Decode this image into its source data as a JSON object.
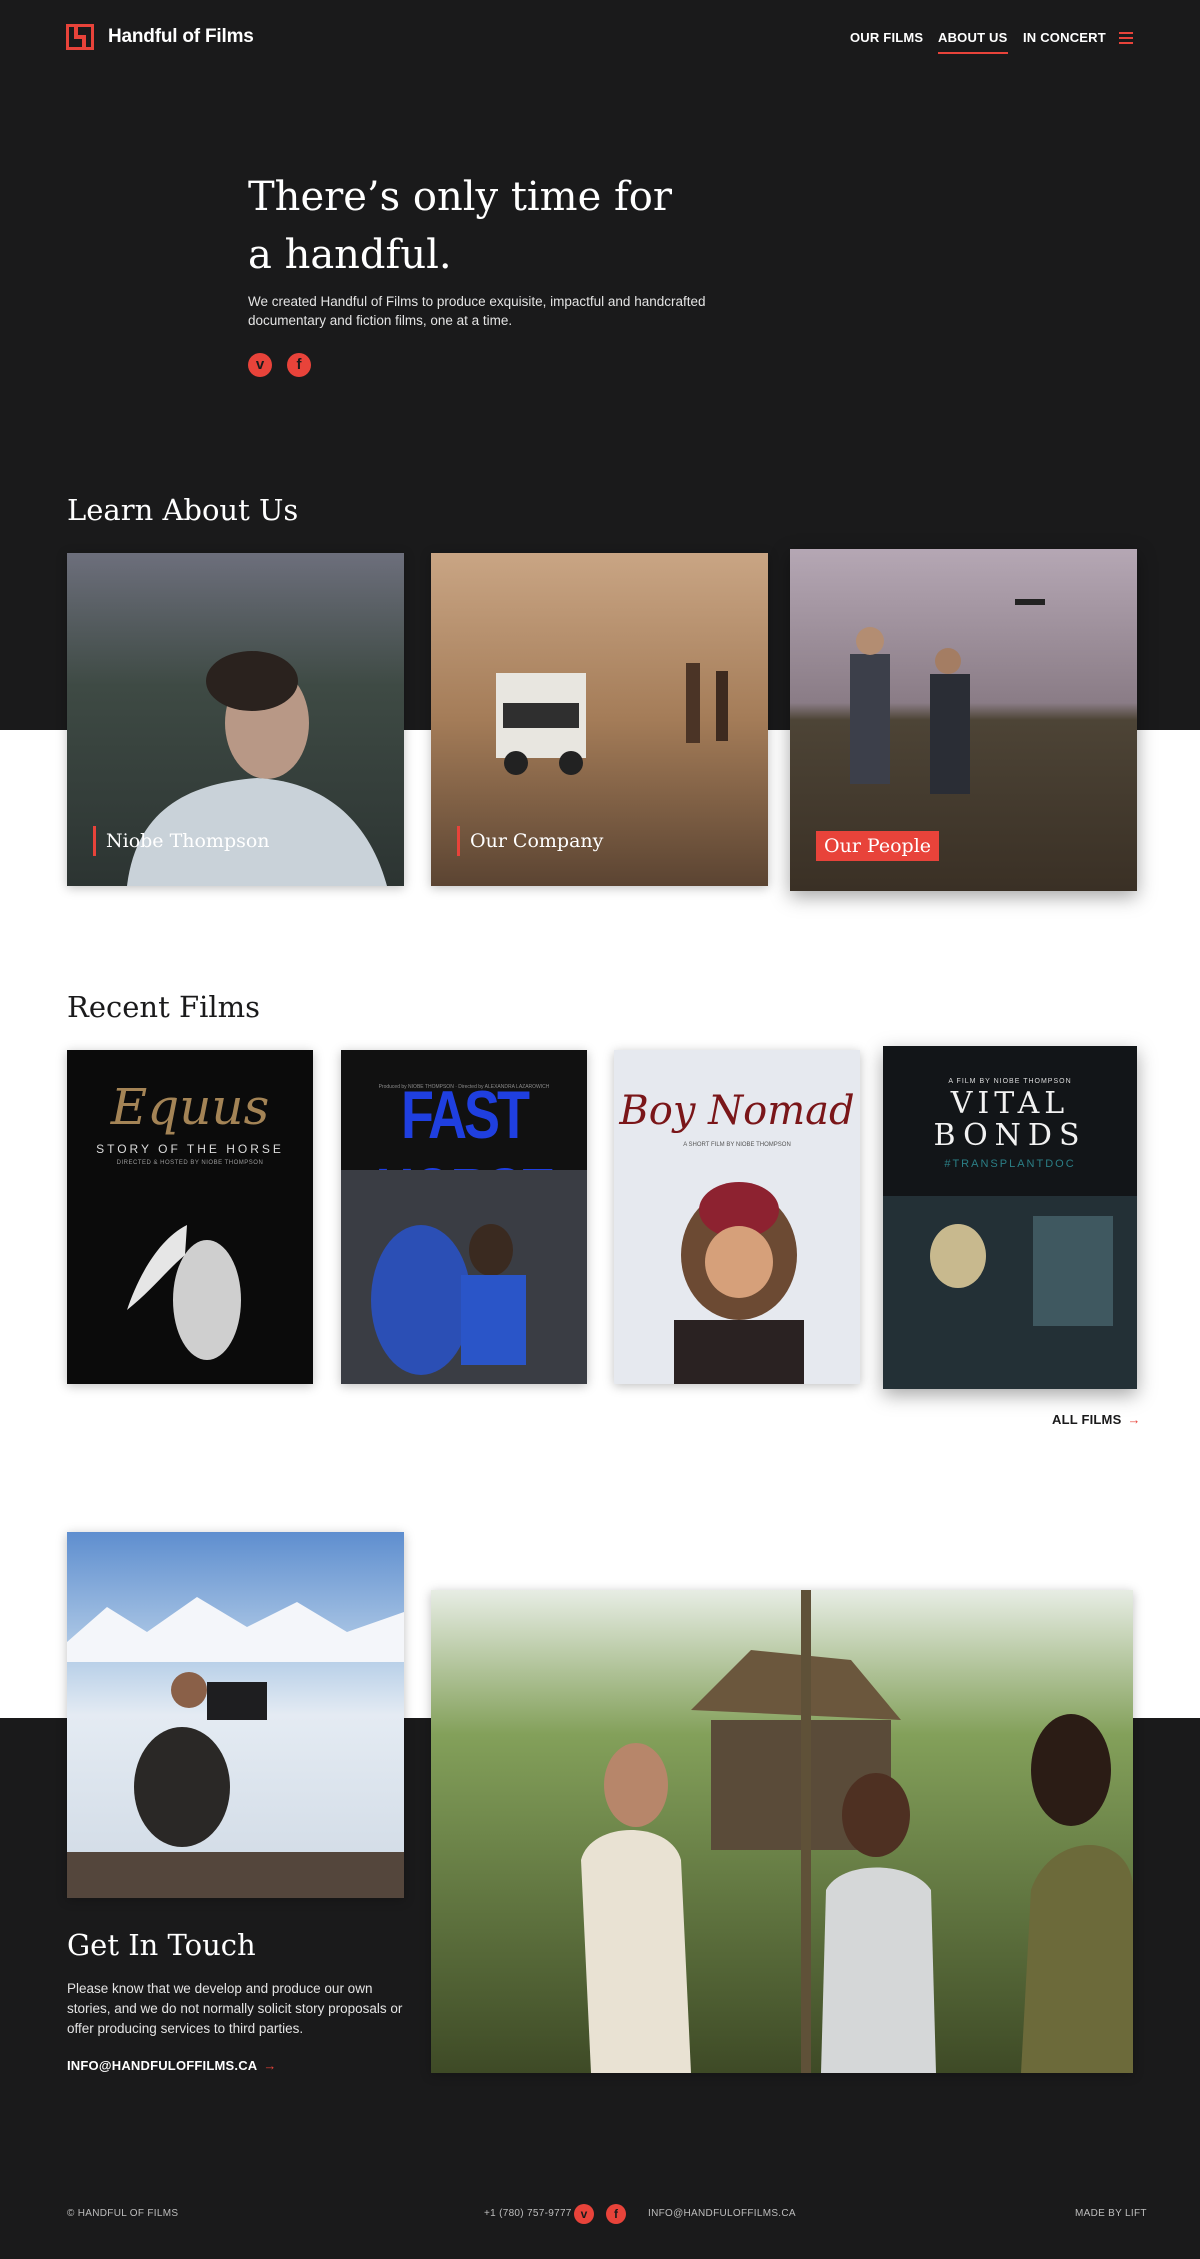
{
  "header": {
    "brand": "Handful of Films",
    "nav": [
      {
        "label": "OUR FILMS",
        "active": false
      },
      {
        "label": "ABOUT US",
        "active": true
      },
      {
        "label": "IN CONCERT",
        "active": false
      }
    ]
  },
  "hero": {
    "title_line1": "There’s only time for",
    "title_line2": "a handful.",
    "subtitle": "We created Handful of Films to produce exquisite, impactful and handcrafted documentary and fiction films, one at a time.",
    "social": [
      {
        "icon": "vimeo-icon",
        "glyph": "v"
      },
      {
        "icon": "facebook-icon",
        "glyph": "f"
      }
    ]
  },
  "about": {
    "title": "Learn About Us",
    "cards": [
      {
        "label": "Niobe Thompson"
      },
      {
        "label": "Our Company"
      },
      {
        "label": "Our People"
      }
    ]
  },
  "films": {
    "title": "Recent Films",
    "posters": [
      {
        "title": "Equus",
        "subtitle": "STORY OF THE HORSE",
        "credit": "DIRECTED & HOSTED BY NIOBE THOMPSON"
      },
      {
        "title": "FAST HORSE",
        "credit": "Produced by NIOBE THOMPSON · Directed by ALEXANDRA LAZAROWICH"
      },
      {
        "title": "Boy Nomad",
        "credit": "A SHORT FILM BY NIOBE THOMPSON"
      },
      {
        "title_line1": "VITAL",
        "title_line2": "BONDS",
        "hashtag": "#TRANSPLANTDOC",
        "credit": "A FILM BY NIOBE THOMPSON"
      }
    ],
    "all_link": "ALL FILMS",
    "arrow": "→"
  },
  "contact": {
    "title": "Get In Touch",
    "text": "Please know that we develop and produce our own stories, and we do not normally solicit story proposals or offer producing services to third parties.",
    "email": "INFO@HANDFULOFFILMS.CA",
    "arrow": "→"
  },
  "footer": {
    "copyright": "© HANDFUL OF FILMS",
    "phone": "+1 (780) 757-9777",
    "email": "INFO@HANDFULOFFILMS.CA",
    "credit": "MADE BY LIFT"
  },
  "colors": {
    "accent": "#e8433a",
    "dark": "#1a1a1b"
  }
}
